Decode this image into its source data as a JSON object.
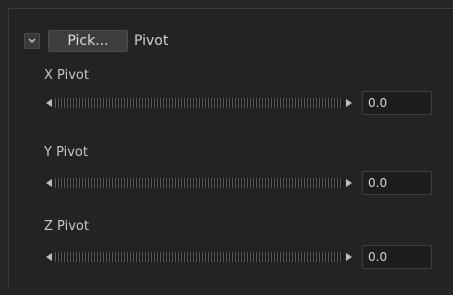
{
  "header": {
    "checkbox_icon": "chevron-down-icon",
    "pick_label": "Pick...",
    "title": "Pivot"
  },
  "controls": [
    {
      "label": "X Pivot",
      "value": "0.0"
    },
    {
      "label": "Y Pivot",
      "value": "0.0"
    },
    {
      "label": "Z Pivot",
      "value": "0.0"
    }
  ],
  "colors": {
    "background": "#262626",
    "panel": "#232323",
    "text": "#cfcfcf"
  }
}
